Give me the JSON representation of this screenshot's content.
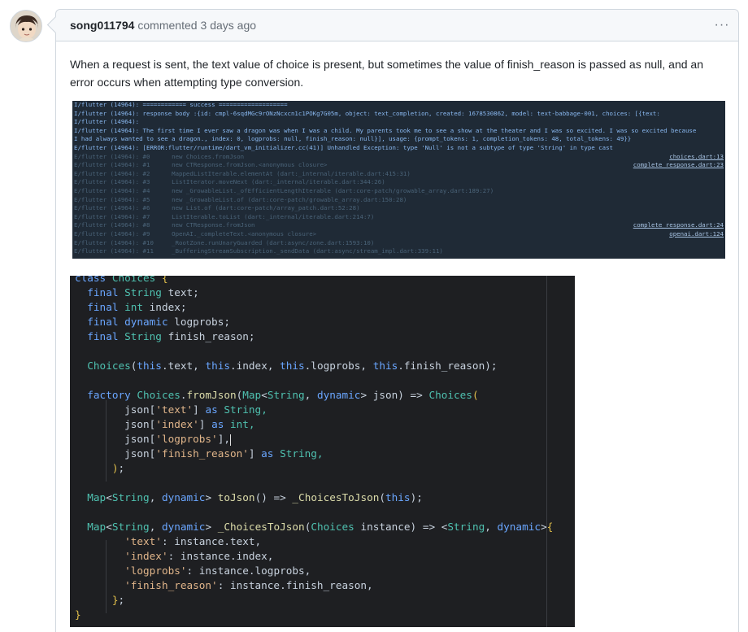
{
  "comment": {
    "author": "song011794",
    "action": "commented",
    "time": "3 days ago",
    "menu_icon": "kebab-horizontal-icon",
    "text": "When a request is sent, the text value of choice is present, but sometimes the value of finish_reason is passed as null, and an error occurs when attempting type conversion."
  },
  "terminal": {
    "lines": [
      {
        "text": "I/flutter (14964): ============ success ===================",
        "style": "first",
        "link": ""
      },
      {
        "text": "I/flutter (14964): response body :{id: cmpl-6sqdMGc9rONzNcxcn1c1POKg7G05m, object: text_completion, created: 1678530862, model: text-babbage-001, choices: [{text:",
        "style": "first",
        "link": ""
      },
      {
        "text": "I/flutter (14964):",
        "style": "first",
        "link": ""
      },
      {
        "text": "I/flutter (14964): The first time I ever saw a dragon was when I was a child. My parents took me to see a show at the theater and I was so excited. I was so excited because",
        "style": "first",
        "link": ""
      },
      {
        "text": "I had always wanted to see a dragon., index: 0, logprobs: null, finish_reason: null}], usage: {prompt_tokens: 1, completion_tokens: 48, total_tokens: 49}}",
        "style": "first",
        "link": ""
      },
      {
        "text": "E/flutter (14964): [ERROR:flutter/runtime/dart_vm_initializer.cc(41)] Unhandled Exception: type 'Null' is not a subtype of type 'String' in type cast",
        "style": "first",
        "link": ""
      },
      {
        "text": "E/flutter (14964): #0      new Choices.fromJson",
        "style": "dim",
        "link": "choices.dart:13"
      },
      {
        "text": "E/flutter (14964): #1      new CTResponse.fromJson.<anonymous closure>",
        "style": "dim",
        "link": "complete_response.dart:23"
      },
      {
        "text": "E/flutter (14964): #2      MappedListIterable.elementAt (dart:_internal/iterable.dart:415:31)",
        "style": "dim",
        "link": ""
      },
      {
        "text": "E/flutter (14964): #3      ListIterator.moveNext (dart:_internal/iterable.dart:344:26)",
        "style": "dim",
        "link": ""
      },
      {
        "text": "E/flutter (14964): #4      new _GrowableList._ofEfficientLengthIterable (dart:core-patch/growable_array.dart:189:27)",
        "style": "dim",
        "link": ""
      },
      {
        "text": "E/flutter (14964): #5      new _GrowableList.of (dart:core-patch/growable_array.dart:150:28)",
        "style": "dim",
        "link": ""
      },
      {
        "text": "E/flutter (14964): #6      new List.of (dart:core-patch/array_patch.dart:52:28)",
        "style": "dim",
        "link": ""
      },
      {
        "text": "E/flutter (14964): #7      ListIterable.toList (dart:_internal/iterable.dart:214:7)",
        "style": "dim",
        "link": ""
      },
      {
        "text": "E/flutter (14964): #8      new CTResponse.fromJson",
        "style": "dim",
        "link": "complete_response.dart:24"
      },
      {
        "text": "E/flutter (14964): #9      OpenAI._completeText.<anonymous closure>",
        "style": "dim",
        "link": "openai.dart:124"
      },
      {
        "text": "E/flutter (14964): #10     _RootZone.runUnaryGuarded (dart:async/zone.dart:1593:10)",
        "style": "dim",
        "link": ""
      },
      {
        "text": "E/flutter (14964): #11     _BufferingStreamSubscription._sendData (dart:async/stream_impl.dart:339:11)",
        "style": "dim",
        "link": ""
      }
    ]
  },
  "code": {
    "lines": [
      [
        {
          "t": "class ",
          "c": "kw"
        },
        {
          "t": "Choices ",
          "c": "ty"
        },
        {
          "t": "{",
          "c": "br"
        }
      ],
      [
        {
          "t": "  final ",
          "c": "kw"
        },
        {
          "t": "String ",
          "c": "ty"
        },
        {
          "t": "text;",
          "c": "pl"
        }
      ],
      [
        {
          "t": "  final ",
          "c": "kw"
        },
        {
          "t": "int ",
          "c": "ty"
        },
        {
          "t": "index;",
          "c": "pl"
        }
      ],
      [
        {
          "t": "  final ",
          "c": "kw"
        },
        {
          "t": "dynamic ",
          "c": "kw"
        },
        {
          "t": "logprobs;",
          "c": "pl"
        }
      ],
      [
        {
          "t": "  final ",
          "c": "kw"
        },
        {
          "t": "String ",
          "c": "ty"
        },
        {
          "t": "finish_reason;",
          "c": "pl"
        }
      ],
      [],
      [
        {
          "t": "  Choices",
          "c": "ty"
        },
        {
          "t": "(",
          "c": "pl"
        },
        {
          "t": "this",
          "c": "kw"
        },
        {
          "t": ".text, ",
          "c": "pl"
        },
        {
          "t": "this",
          "c": "kw"
        },
        {
          "t": ".index, ",
          "c": "pl"
        },
        {
          "t": "this",
          "c": "kw"
        },
        {
          "t": ".logprobs, ",
          "c": "pl"
        },
        {
          "t": "this",
          "c": "kw"
        },
        {
          "t": ".finish_reason);",
          "c": "pl"
        }
      ],
      [],
      [
        {
          "t": "  factory ",
          "c": "kw"
        },
        {
          "t": "Choices",
          "c": "ty"
        },
        {
          "t": ".",
          "c": "pl"
        },
        {
          "t": "fromJson",
          "c": "fn"
        },
        {
          "t": "(",
          "c": "pl"
        },
        {
          "t": "Map",
          "c": "ty"
        },
        {
          "t": "<",
          "c": "pl"
        },
        {
          "t": "String",
          "c": "ty"
        },
        {
          "t": ", ",
          "c": "pl"
        },
        {
          "t": "dynamic",
          "c": "kw"
        },
        {
          "t": "> json) => ",
          "c": "pl"
        },
        {
          "t": "Choices",
          "c": "ty"
        },
        {
          "t": "(",
          "c": "br"
        }
      ],
      [
        {
          "t": "        json[",
          "c": "pl"
        },
        {
          "t": "'text'",
          "c": "st"
        },
        {
          "t": "] ",
          "c": "pl"
        },
        {
          "t": "as ",
          "c": "kw"
        },
        {
          "t": "String,",
          "c": "ty"
        }
      ],
      [
        {
          "t": "        json[",
          "c": "pl"
        },
        {
          "t": "'index'",
          "c": "st"
        },
        {
          "t": "] ",
          "c": "pl"
        },
        {
          "t": "as ",
          "c": "kw"
        },
        {
          "t": "int,",
          "c": "ty"
        }
      ],
      [
        {
          "t": "        json[",
          "c": "pl"
        },
        {
          "t": "'logprobs'",
          "c": "st"
        },
        {
          "t": "],",
          "c": "pl"
        },
        {
          "t": "|",
          "c": "cursor"
        }
      ],
      [
        {
          "t": "        json[",
          "c": "pl"
        },
        {
          "t": "'finish_reason'",
          "c": "st"
        },
        {
          "t": "] ",
          "c": "pl"
        },
        {
          "t": "as ",
          "c": "kw"
        },
        {
          "t": "String,",
          "c": "ty"
        }
      ],
      [
        {
          "t": "      ",
          "c": "pl"
        },
        {
          "t": ")",
          "c": "br"
        },
        {
          "t": ";",
          "c": "pl"
        }
      ],
      [],
      [
        {
          "t": "  Map",
          "c": "ty"
        },
        {
          "t": "<",
          "c": "pl"
        },
        {
          "t": "String",
          "c": "ty"
        },
        {
          "t": ", ",
          "c": "pl"
        },
        {
          "t": "dynamic",
          "c": "kw"
        },
        {
          "t": "> ",
          "c": "pl"
        },
        {
          "t": "toJson",
          "c": "fn"
        },
        {
          "t": "() => ",
          "c": "pl"
        },
        {
          "t": "_ChoicesToJson",
          "c": "fn"
        },
        {
          "t": "(",
          "c": "pl"
        },
        {
          "t": "this",
          "c": "kw"
        },
        {
          "t": ");",
          "c": "pl"
        }
      ],
      [],
      [
        {
          "t": "  Map",
          "c": "ty"
        },
        {
          "t": "<",
          "c": "pl"
        },
        {
          "t": "String",
          "c": "ty"
        },
        {
          "t": ", ",
          "c": "pl"
        },
        {
          "t": "dynamic",
          "c": "kw"
        },
        {
          "t": "> ",
          "c": "pl"
        },
        {
          "t": "_ChoicesToJson",
          "c": "fn"
        },
        {
          "t": "(",
          "c": "pl"
        },
        {
          "t": "Choices ",
          "c": "ty"
        },
        {
          "t": "instance) => <",
          "c": "pl"
        },
        {
          "t": "String",
          "c": "ty"
        },
        {
          "t": ", ",
          "c": "pl"
        },
        {
          "t": "dynamic",
          "c": "kw"
        },
        {
          "t": ">",
          "c": "pl"
        },
        {
          "t": "{",
          "c": "br"
        }
      ],
      [
        {
          "t": "        ",
          "c": "pl"
        },
        {
          "t": "'text'",
          "c": "st"
        },
        {
          "t": ": instance.text,",
          "c": "pl"
        }
      ],
      [
        {
          "t": "        ",
          "c": "pl"
        },
        {
          "t": "'index'",
          "c": "st"
        },
        {
          "t": ": instance.index,",
          "c": "pl"
        }
      ],
      [
        {
          "t": "        ",
          "c": "pl"
        },
        {
          "t": "'logprobs'",
          "c": "st"
        },
        {
          "t": ": instance.logprobs,",
          "c": "pl"
        }
      ],
      [
        {
          "t": "        ",
          "c": "pl"
        },
        {
          "t": "'finish_reason'",
          "c": "st"
        },
        {
          "t": ": instance.finish_reason,",
          "c": "pl"
        }
      ],
      [
        {
          "t": "      ",
          "c": "pl"
        },
        {
          "t": "}",
          "c": "br"
        },
        {
          "t": ";",
          "c": "pl"
        }
      ],
      [
        {
          "t": "}",
          "c": "br"
        }
      ]
    ]
  }
}
